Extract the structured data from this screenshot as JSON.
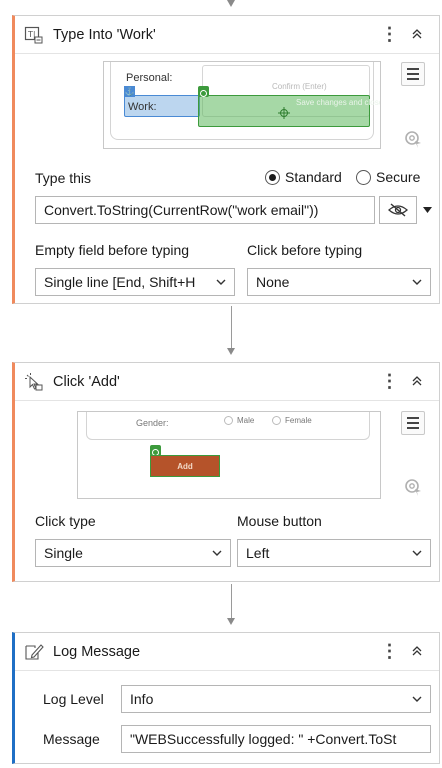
{
  "type_into": {
    "title": "Type Into 'Work'",
    "preview": {
      "personal_label": "Personal:",
      "work_label": "Work:",
      "confirm_label": "Confirm (Enter)",
      "save_label": "Save changes and close"
    },
    "type_this_label": "Type this",
    "mode_standard": "Standard",
    "mode_secure": "Secure",
    "expression": "Convert.ToString(CurrentRow(\"work email\"))",
    "empty_field_label": "Empty field before typing",
    "empty_field_value": "Single line [End, Shift+H",
    "click_before_label": "Click before typing",
    "click_before_value": "None"
  },
  "click_add": {
    "title": "Click 'Add'",
    "preview": {
      "gender_label": "Gender:",
      "male_label": "Male",
      "female_label": "Female",
      "add_label": "Add"
    },
    "click_type_label": "Click type",
    "click_type_value": "Single",
    "mouse_button_label": "Mouse button",
    "mouse_button_value": "Left"
  },
  "log_message": {
    "title": "Log Message",
    "log_level_label": "Log Level",
    "log_level_value": "Info",
    "message_label": "Message",
    "message_value": "\"WEBSuccessfully logged: \" +Convert.ToSt"
  },
  "colors": {
    "ui_accent": "#f08a5d",
    "log_accent": "#1f6fc5",
    "add_button": "#b5532a",
    "highlight_green": "#5cb85c",
    "highlight_blue": "#5b9bd5"
  }
}
